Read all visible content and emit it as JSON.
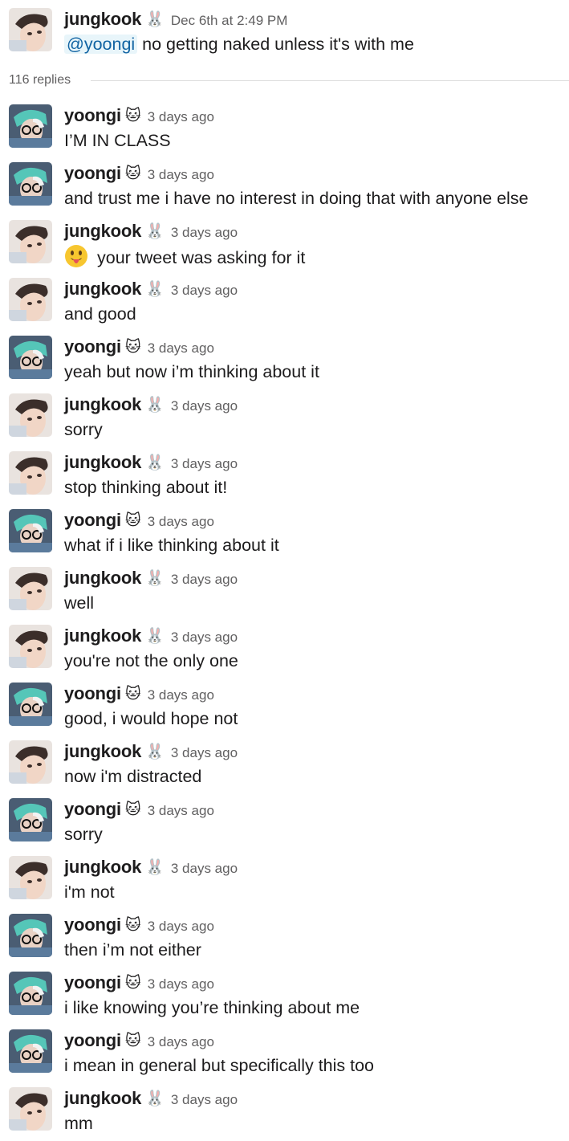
{
  "parent": {
    "author": "jungkook",
    "badge": "🐰",
    "time": "Dec 6th at 2:49 PM",
    "mention": "@yoongi",
    "text": "no getting naked unless it's with me"
  },
  "replies_label": "116 replies",
  "replies": [
    {
      "author": "yoongi",
      "badge": "🐱",
      "time": "3 days ago",
      "text": "I’M IN CLASS"
    },
    {
      "author": "yoongi",
      "badge": "🐱",
      "time": "3 days ago",
      "text": "and trust me i have no interest in doing that with anyone else"
    },
    {
      "author": "jungkook",
      "badge": "🐰",
      "time": "3 days ago",
      "text": "your tweet was asking for it",
      "emoji": "stuck-out-tongue-face"
    },
    {
      "author": "jungkook",
      "badge": "🐰",
      "time": "3 days ago",
      "text": "and good"
    },
    {
      "author": "yoongi",
      "badge": "🐱",
      "time": "3 days ago",
      "text": "yeah but now i’m thinking about it"
    },
    {
      "author": "jungkook",
      "badge": "🐰",
      "time": "3 days ago",
      "text": "sorry"
    },
    {
      "author": "jungkook",
      "badge": "🐰",
      "time": "3 days ago",
      "text": "stop thinking about it!"
    },
    {
      "author": "yoongi",
      "badge": "🐱",
      "time": "3 days ago",
      "text": "what if i like thinking about it"
    },
    {
      "author": "jungkook",
      "badge": "🐰",
      "time": "3 days ago",
      "text": "well"
    },
    {
      "author": "jungkook",
      "badge": "🐰",
      "time": "3 days ago",
      "text": "you're not the only one"
    },
    {
      "author": "yoongi",
      "badge": "🐱",
      "time": "3 days ago",
      "text": "good, i would hope not"
    },
    {
      "author": "jungkook",
      "badge": "🐰",
      "time": "3 days ago",
      "text": "now i'm distracted"
    },
    {
      "author": "yoongi",
      "badge": "🐱",
      "time": "3 days ago",
      "text": "sorry"
    },
    {
      "author": "jungkook",
      "badge": "🐰",
      "time": "3 days ago",
      "text": "i'm not"
    },
    {
      "author": "yoongi",
      "badge": "🐱",
      "time": "3 days ago",
      "text": "then i’m not either"
    },
    {
      "author": "yoongi",
      "badge": "🐱",
      "time": "3 days ago",
      "text": "i like knowing you’re thinking about me"
    },
    {
      "author": "yoongi",
      "badge": "🐱",
      "time": "3 days ago",
      "text": "i mean in general but specifically this too"
    },
    {
      "author": "jungkook",
      "badge": "🐰",
      "time": "3 days ago",
      "text": "mm"
    }
  ],
  "colors": {
    "mention_bg": "#e8f5fa",
    "mention_text": "#1264a3",
    "timestamp": "#616061",
    "divider": "#dddddd",
    "text": "#1d1c1d"
  },
  "icons": {
    "jungkook_avatar": "avatar-jungkook",
    "yoongi_avatar": "avatar-yoongi"
  }
}
